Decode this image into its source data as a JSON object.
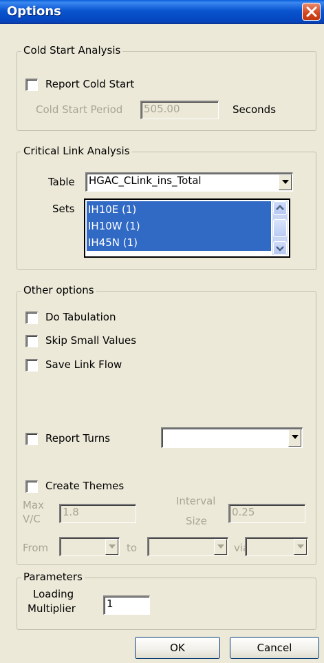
{
  "window": {
    "title": "Options"
  },
  "cold_start": {
    "group_label": "Cold Start Analysis",
    "report_label": "Report Cold Start",
    "report_checked": false,
    "period_label": "Cold Start Period",
    "period_value": "505.00",
    "period_unit": "Seconds"
  },
  "critical_link": {
    "group_label": "Critical Link Analysis",
    "table_label": "Table",
    "table_value": "HGAC_CLink_ins_Total",
    "sets_label": "Sets",
    "sets": [
      "IH10E (1)",
      "IH10W (1)",
      "IH45N (1)"
    ]
  },
  "other": {
    "group_label": "Other options",
    "do_tabulation": "Do Tabulation",
    "skip_small_values": "Skip Small Values",
    "save_link_flow": "Save Link Flow",
    "report_turns": "Report Turns",
    "report_turns_value": "",
    "create_themes": "Create Themes",
    "max_vc_label_1": "Max",
    "max_vc_label_2": "V/C",
    "max_vc_value": "1.8",
    "interval_label_1": "Interval",
    "interval_label_2": "Size",
    "interval_value": "0.25",
    "from_label": "From",
    "to_label": "to",
    "via_label": "via"
  },
  "parameters": {
    "group_label": "Parameters",
    "loading_label_1": "Loading",
    "loading_label_2": "Multiplier",
    "loading_value": "1"
  },
  "buttons": {
    "ok": "OK",
    "cancel": "Cancel"
  }
}
